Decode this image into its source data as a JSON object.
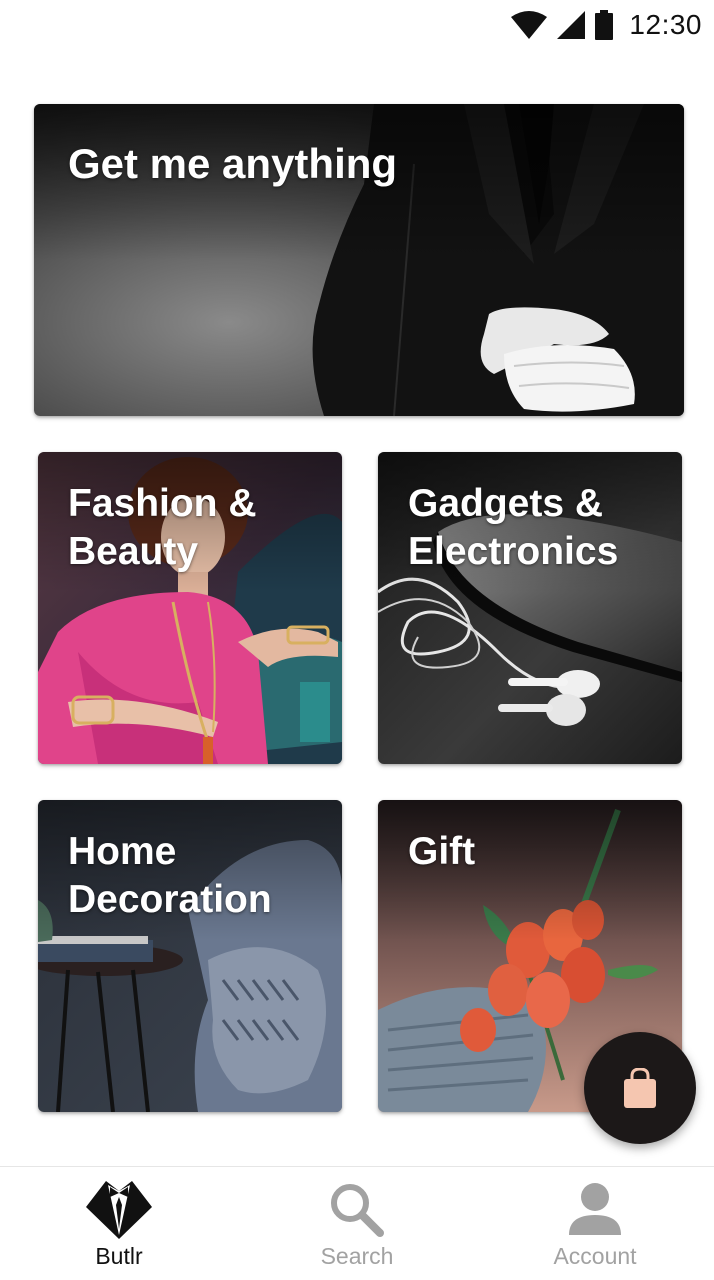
{
  "status_bar": {
    "time": "12:30",
    "icons": [
      "wifi-icon",
      "cell-signal-icon",
      "battery-icon"
    ]
  },
  "hero": {
    "title": "Get me anything"
  },
  "categories": [
    {
      "title": "Fashion &\nBeauty"
    },
    {
      "title": "Gadgets &\nElectronics"
    },
    {
      "title": "Home\nDecoration"
    },
    {
      "title": "Gift"
    }
  ],
  "fab": {
    "icon": "shopping-bag-icon",
    "icon_color": "#f5c6b0",
    "background": "#1c1818"
  },
  "bottom_nav": {
    "items": [
      {
        "label": "Butlr",
        "icon": "tuxedo-icon",
        "active": true
      },
      {
        "label": "Search",
        "icon": "search-icon",
        "active": false
      },
      {
        "label": "Account",
        "icon": "account-icon",
        "active": false
      }
    ],
    "active_color": "#111111",
    "inactive_color": "#a2a2a2"
  }
}
